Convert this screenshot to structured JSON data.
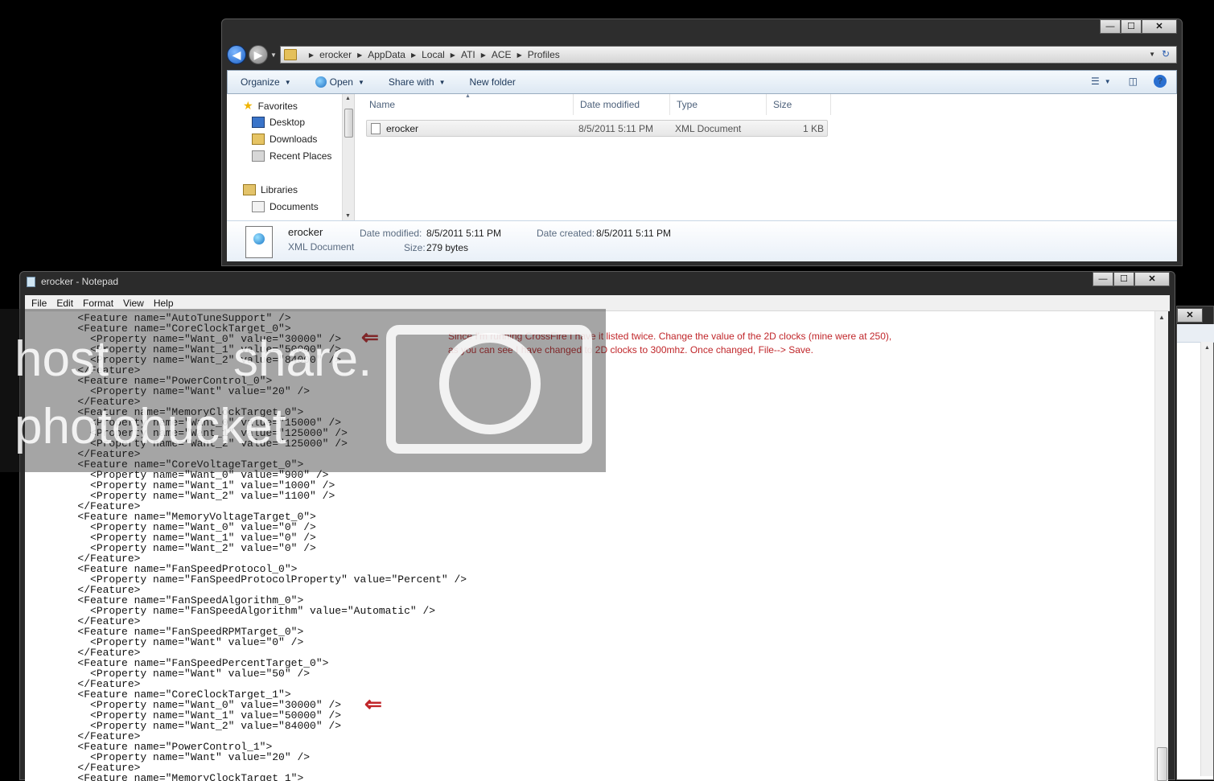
{
  "explorer": {
    "window_controls": {
      "minimize": "—",
      "maximize": "☐",
      "close": "✕"
    },
    "breadcrumb": [
      "erocker",
      "AppData",
      "Local",
      "ATI",
      "ACE",
      "Profiles"
    ],
    "toolbar": {
      "organize": "Organize",
      "open": "Open",
      "share_with": "Share with",
      "new_folder": "New folder"
    },
    "nav": {
      "favorites": "Favorites",
      "desktop": "Desktop",
      "downloads": "Downloads",
      "recent_places": "Recent Places",
      "libraries": "Libraries",
      "documents": "Documents"
    },
    "columns": {
      "name": "Name",
      "date_modified": "Date modified",
      "type": "Type",
      "size": "Size"
    },
    "file": {
      "name": "erocker",
      "date_modified": "8/5/2011 5:11 PM",
      "type": "XML Document",
      "size": "1 KB"
    },
    "details": {
      "name": "erocker",
      "type": "XML Document",
      "date_modified_label": "Date modified:",
      "date_modified": "8/5/2011 5:11 PM",
      "date_created_label": "Date created:",
      "date_created": "8/5/2011 5:11 PM",
      "size_label": "Size:",
      "size": "279 bytes"
    }
  },
  "notepad": {
    "title": "erocker - Notepad",
    "menu": [
      "File",
      "Edit",
      "Format",
      "View",
      "Help"
    ],
    "content": "        <Feature name=\"AutoTuneSupport\" />\n        <Feature name=\"CoreClockTarget_0\">\n          <Property name=\"Want_0\" value=\"30000\" />\n          <Property name=\"Want_1\" value=\"50000\" />\n          <Property name=\"Want_2\" value=\"84000\" />\n        </Feature>\n        <Feature name=\"PowerControl_0\">\n          <Property name=\"Want\" value=\"20\" />\n        </Feature>\n        <Feature name=\"MemoryClockTarget_0\">\n          <Property name=\"Want_0\" value=\"15000\" />\n          <Property name=\"Want_1\" value=\"125000\" />\n          <Property name=\"Want_2\" value=\"125000\" />\n        </Feature>\n        <Feature name=\"CoreVoltageTarget_0\">\n          <Property name=\"Want_0\" value=\"900\" />\n          <Property name=\"Want_1\" value=\"1000\" />\n          <Property name=\"Want_2\" value=\"1100\" />\n        </Feature>\n        <Feature name=\"MemoryVoltageTarget_0\">\n          <Property name=\"Want_0\" value=\"0\" />\n          <Property name=\"Want_1\" value=\"0\" />\n          <Property name=\"Want_2\" value=\"0\" />\n        </Feature>\n        <Feature name=\"FanSpeedProtocol_0\">\n          <Property name=\"FanSpeedProtocolProperty\" value=\"Percent\" />\n        </Feature>\n        <Feature name=\"FanSpeedAlgorithm_0\">\n          <Property name=\"FanSpeedAlgorithm\" value=\"Automatic\" />\n        </Feature>\n        <Feature name=\"FanSpeedRPMTarget_0\">\n          <Property name=\"Want\" value=\"0\" />\n        </Feature>\n        <Feature name=\"FanSpeedPercentTarget_0\">\n          <Property name=\"Want\" value=\"50\" />\n        </Feature>\n        <Feature name=\"CoreClockTarget_1\">\n          <Property name=\"Want_0\" value=\"30000\" />\n          <Property name=\"Want_1\" value=\"50000\" />\n          <Property name=\"Want_2\" value=\"84000\" />\n        </Feature>\n        <Feature name=\"PowerControl_1\">\n          <Property name=\"Want\" value=\"20\" />\n        </Feature>\n        <Feature name=\"MemoryClockTarget_1\">"
  },
  "annotation": {
    "text": "Since I'm running CrossFire I have it listed twice. Change the value of the 2D clocks (mine were at 250), as you can see I have changed to 2D clocks to 300mhz. Once changed, File--> Save.",
    "arrow_glyph": "⇐"
  },
  "watermark": {
    "line1": "host",
    "line2": "share.",
    "line3": "photobucket"
  },
  "colors": {
    "annotation": "#c0262a",
    "desktop_bg": "#000000"
  }
}
